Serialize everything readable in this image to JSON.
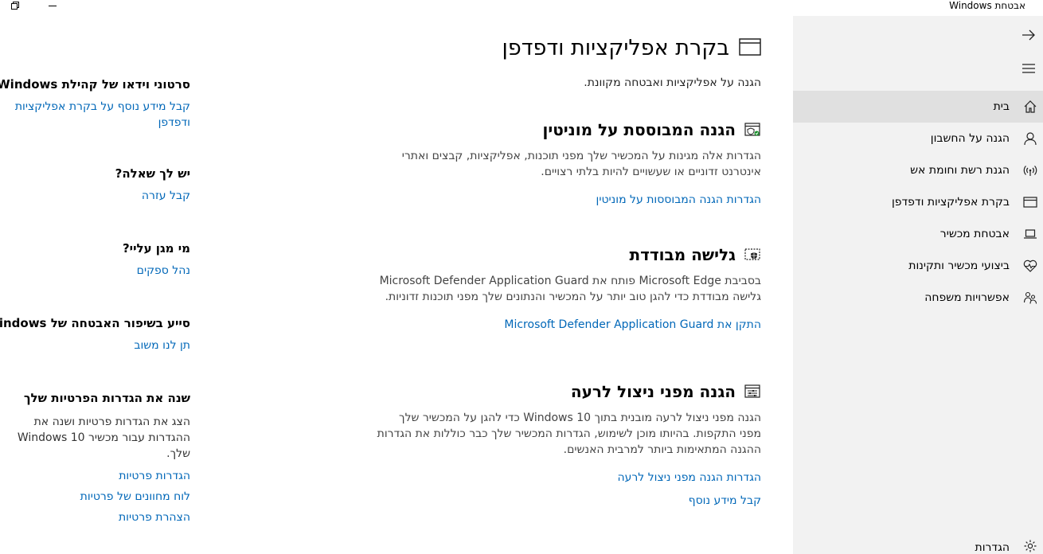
{
  "window": {
    "title": "אבטחת Windows"
  },
  "nav": {
    "items": [
      {
        "label": "בית",
        "icon": "home-icon",
        "active": true
      },
      {
        "label": "הגנה על החשבון",
        "icon": "person-icon"
      },
      {
        "label": "הגנת רשת וחומת אש",
        "icon": "wireless-icon"
      },
      {
        "label": "בקרת אפליקציות ודפדפן",
        "icon": "app-browser-icon"
      },
      {
        "label": "אבטחת מכשיר",
        "icon": "laptop-icon"
      },
      {
        "label": "ביצועי מכשיר ותקינות",
        "icon": "heart-pulse-icon"
      },
      {
        "label": "אפשרויות משפחה",
        "icon": "family-icon"
      }
    ],
    "settings_label": "הגדרות"
  },
  "main": {
    "title": "בקרת אפליקציות ודפדפן",
    "subtitle": "הגנה על אפליקציות ואבטחה מקוונת.",
    "sections": [
      {
        "title": "הגנה המבוססת על מוניטין",
        "icon": "reputation-shield-icon",
        "desc": "הגדרות אלה מגינות על המכשיר שלך מפני תוכנות, אפליקציות, קבצים ואתרי אינטרנט זדוניים או שעשויים להיות בלתי רצויים.",
        "links": [
          "הגדרות הגנה המבוססות על מוניטין"
        ]
      },
      {
        "title": "גלישה מבודדת",
        "icon": "isolated-browsing-icon",
        "desc": "בסביבת Microsoft Edge פותח את Microsoft Defender Application Guard גלישה מבודדת כדי להגן טוב יותר על המכשיר והנתונים שלך מפני תוכנות זדוניות.",
        "links": [
          "התקן את Microsoft Defender Application Guard"
        ]
      },
      {
        "title": "הגנה מפני ניצול לרעה",
        "icon": "exploit-protection-icon",
        "desc": "הגנה מפני ניצול לרעה מובנית בתוך Windows 10 כדי להגן על המכשיר שלך מפני התקפות. בהיותו מוכן לשימוש, הגדרות המכשיר שלך כבר כוללות את הגדרות ההגנה המתאימות ביותר למרבית האנשים.",
        "links": [
          "הגדרות הגנה מפני ניצול לרעה",
          "קבל מידע נוסף"
        ]
      }
    ]
  },
  "side": {
    "blocks": [
      {
        "heading": "סרטוני וידאו של קהילת Windows",
        "links": [
          "קבל מידע נוסף על בקרת אפליקציות ודפדפן"
        ]
      },
      {
        "heading": "יש לך שאלה?",
        "links": [
          "קבל עזרה"
        ]
      },
      {
        "heading": "מי מגן עליי?",
        "links": [
          "נהל ספקים"
        ]
      },
      {
        "heading": "סייע בשיפור האבטחה של Windows",
        "links": [
          "תן לנו משוב"
        ]
      },
      {
        "heading": "שנה את הגדרות הפרטיות שלך",
        "text": "הצג את הגדרות פרטיות ושנה את ההגדרות עבור מכשיר Windows 10 שלך.",
        "links": [
          "הגדרות פרטיות",
          "לוח מחוונים של פרטיות",
          "הצהרת פרטיות"
        ]
      }
    ]
  },
  "colors": {
    "link": "#0067b8",
    "nav_bg": "#f2f2f2",
    "nav_active": "#e0e0e0"
  }
}
